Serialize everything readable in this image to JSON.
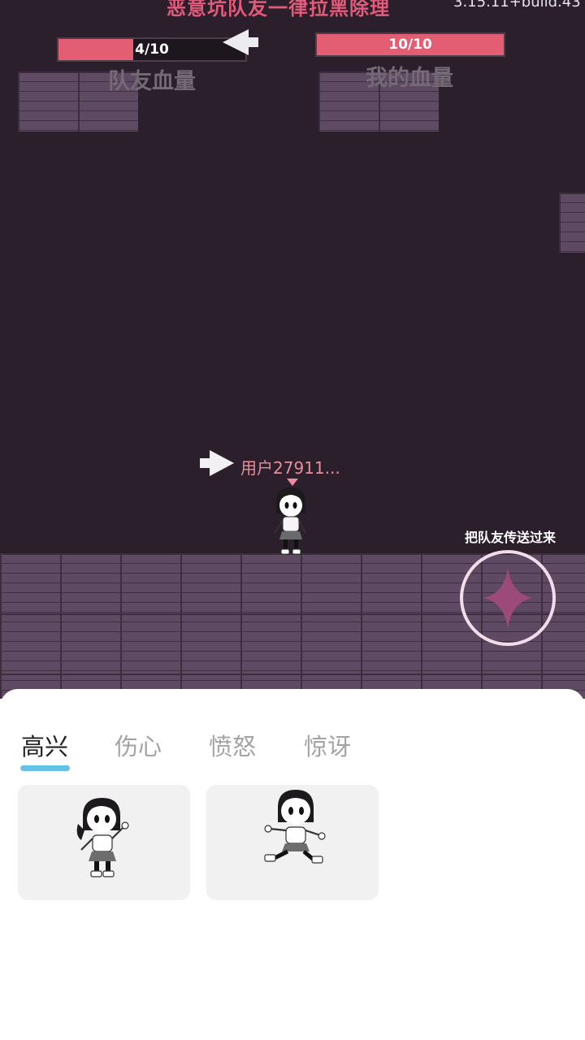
{
  "banner": {
    "text": "恶意坑队友一律拉黑除理",
    "version": "3.15.11+build.43"
  },
  "hud": {
    "teammate": {
      "value": 4,
      "max": 10,
      "text": "4/10",
      "label": "队友血量"
    },
    "mine": {
      "value": 10,
      "max": 10,
      "text": "10/10",
      "label": "我的血量"
    }
  },
  "player": {
    "name": "用户27911..."
  },
  "teleport": {
    "label": "把队友传送过来",
    "icon": "sparkle-icon"
  },
  "colors": {
    "background": "#2b1f2c",
    "brick": "#5e4a62",
    "health": "#e35e72",
    "accent": "#63c2e6"
  },
  "emote_panel": {
    "tabs": [
      {
        "label": "高兴",
        "active": true
      },
      {
        "label": "伤心",
        "active": false
      },
      {
        "label": "愤怒",
        "active": false
      },
      {
        "label": "惊讶",
        "active": false
      }
    ],
    "items": [
      {
        "icon": "girl-waving-emote"
      },
      {
        "icon": "girl-jumping-emote"
      }
    ]
  }
}
